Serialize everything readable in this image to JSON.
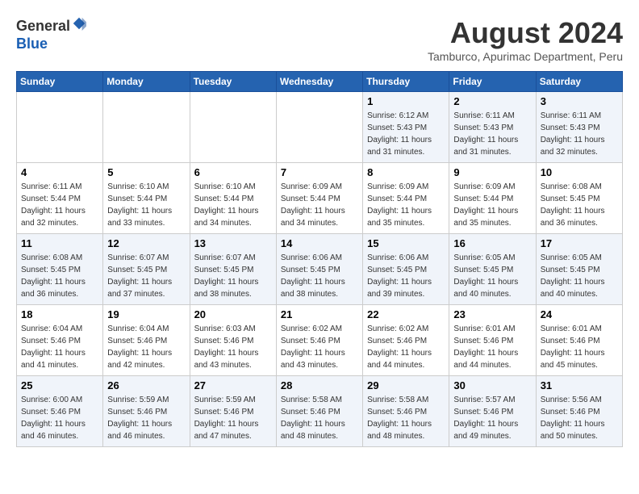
{
  "header": {
    "logo_line1": "General",
    "logo_line2": "Blue",
    "month_title": "August 2024",
    "subtitle": "Tamburco, Apurimac Department, Peru"
  },
  "days_of_week": [
    "Sunday",
    "Monday",
    "Tuesday",
    "Wednesday",
    "Thursday",
    "Friday",
    "Saturday"
  ],
  "weeks": [
    [
      {
        "day": "",
        "info": ""
      },
      {
        "day": "",
        "info": ""
      },
      {
        "day": "",
        "info": ""
      },
      {
        "day": "",
        "info": ""
      },
      {
        "day": "1",
        "info": "Sunrise: 6:12 AM\nSunset: 5:43 PM\nDaylight: 11 hours\nand 31 minutes."
      },
      {
        "day": "2",
        "info": "Sunrise: 6:11 AM\nSunset: 5:43 PM\nDaylight: 11 hours\nand 31 minutes."
      },
      {
        "day": "3",
        "info": "Sunrise: 6:11 AM\nSunset: 5:43 PM\nDaylight: 11 hours\nand 32 minutes."
      }
    ],
    [
      {
        "day": "4",
        "info": "Sunrise: 6:11 AM\nSunset: 5:44 PM\nDaylight: 11 hours\nand 32 minutes."
      },
      {
        "day": "5",
        "info": "Sunrise: 6:10 AM\nSunset: 5:44 PM\nDaylight: 11 hours\nand 33 minutes."
      },
      {
        "day": "6",
        "info": "Sunrise: 6:10 AM\nSunset: 5:44 PM\nDaylight: 11 hours\nand 34 minutes."
      },
      {
        "day": "7",
        "info": "Sunrise: 6:09 AM\nSunset: 5:44 PM\nDaylight: 11 hours\nand 34 minutes."
      },
      {
        "day": "8",
        "info": "Sunrise: 6:09 AM\nSunset: 5:44 PM\nDaylight: 11 hours\nand 35 minutes."
      },
      {
        "day": "9",
        "info": "Sunrise: 6:09 AM\nSunset: 5:44 PM\nDaylight: 11 hours\nand 35 minutes."
      },
      {
        "day": "10",
        "info": "Sunrise: 6:08 AM\nSunset: 5:45 PM\nDaylight: 11 hours\nand 36 minutes."
      }
    ],
    [
      {
        "day": "11",
        "info": "Sunrise: 6:08 AM\nSunset: 5:45 PM\nDaylight: 11 hours\nand 36 minutes."
      },
      {
        "day": "12",
        "info": "Sunrise: 6:07 AM\nSunset: 5:45 PM\nDaylight: 11 hours\nand 37 minutes."
      },
      {
        "day": "13",
        "info": "Sunrise: 6:07 AM\nSunset: 5:45 PM\nDaylight: 11 hours\nand 38 minutes."
      },
      {
        "day": "14",
        "info": "Sunrise: 6:06 AM\nSunset: 5:45 PM\nDaylight: 11 hours\nand 38 minutes."
      },
      {
        "day": "15",
        "info": "Sunrise: 6:06 AM\nSunset: 5:45 PM\nDaylight: 11 hours\nand 39 minutes."
      },
      {
        "day": "16",
        "info": "Sunrise: 6:05 AM\nSunset: 5:45 PM\nDaylight: 11 hours\nand 40 minutes."
      },
      {
        "day": "17",
        "info": "Sunrise: 6:05 AM\nSunset: 5:45 PM\nDaylight: 11 hours\nand 40 minutes."
      }
    ],
    [
      {
        "day": "18",
        "info": "Sunrise: 6:04 AM\nSunset: 5:46 PM\nDaylight: 11 hours\nand 41 minutes."
      },
      {
        "day": "19",
        "info": "Sunrise: 6:04 AM\nSunset: 5:46 PM\nDaylight: 11 hours\nand 42 minutes."
      },
      {
        "day": "20",
        "info": "Sunrise: 6:03 AM\nSunset: 5:46 PM\nDaylight: 11 hours\nand 43 minutes."
      },
      {
        "day": "21",
        "info": "Sunrise: 6:02 AM\nSunset: 5:46 PM\nDaylight: 11 hours\nand 43 minutes."
      },
      {
        "day": "22",
        "info": "Sunrise: 6:02 AM\nSunset: 5:46 PM\nDaylight: 11 hours\nand 44 minutes."
      },
      {
        "day": "23",
        "info": "Sunrise: 6:01 AM\nSunset: 5:46 PM\nDaylight: 11 hours\nand 44 minutes."
      },
      {
        "day": "24",
        "info": "Sunrise: 6:01 AM\nSunset: 5:46 PM\nDaylight: 11 hours\nand 45 minutes."
      }
    ],
    [
      {
        "day": "25",
        "info": "Sunrise: 6:00 AM\nSunset: 5:46 PM\nDaylight: 11 hours\nand 46 minutes."
      },
      {
        "day": "26",
        "info": "Sunrise: 5:59 AM\nSunset: 5:46 PM\nDaylight: 11 hours\nand 46 minutes."
      },
      {
        "day": "27",
        "info": "Sunrise: 5:59 AM\nSunset: 5:46 PM\nDaylight: 11 hours\nand 47 minutes."
      },
      {
        "day": "28",
        "info": "Sunrise: 5:58 AM\nSunset: 5:46 PM\nDaylight: 11 hours\nand 48 minutes."
      },
      {
        "day": "29",
        "info": "Sunrise: 5:58 AM\nSunset: 5:46 PM\nDaylight: 11 hours\nand 48 minutes."
      },
      {
        "day": "30",
        "info": "Sunrise: 5:57 AM\nSunset: 5:46 PM\nDaylight: 11 hours\nand 49 minutes."
      },
      {
        "day": "31",
        "info": "Sunrise: 5:56 AM\nSunset: 5:46 PM\nDaylight: 11 hours\nand 50 minutes."
      }
    ]
  ]
}
